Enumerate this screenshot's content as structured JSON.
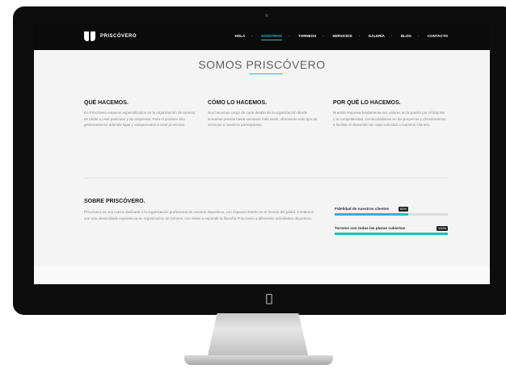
{
  "nav": {
    "logo_text": "PRISCÓVERO",
    "items": [
      "HOLA",
      "NOSOTROS",
      "TORNEOS",
      "SERVICIOS",
      "GALERÍA",
      "BLOG",
      "CONTACTO"
    ],
    "active_index": 1
  },
  "main": {
    "title": "SOMOS PRISCÓVERO",
    "columns": [
      {
        "heading": "QUÉ HACEMOS.",
        "text": "En Priscóvero estamos especializados en la organización de torneos de pádel a nivel particular y de empresas. Para el próximo año gestionaremos además ligas y campeonatos a nivel provincial."
      },
      {
        "heading": "CÓMO LO HACEMOS.",
        "text": "Nos hacemos cargo de cada detalle de la organización desde semanas previas hasta semanas más tarde, ofreciendo todo tipo de servicios a nuestros participantes."
      },
      {
        "heading": "POR QUÉ LO HACEMOS.",
        "text": "Nuestra empresa fundamenta sus valores en la pasión por el deporte y la competitividad, involucrándonos en los proyectos y ofreciéndonos a facilitar el desarrollo de cada actividad a nuestros clientes."
      }
    ],
    "about": {
      "heading": "SOBRE PRISCÓVERO.",
      "text": "Priscóvero es una marca dedicada a la organización profesional de eventos deportivos, con especial interés en el mundo del pádel. Contamos con una desarrollada experiencia en organización de torneos, con vistas a expandir la filosofía Priscóvero a diferentes actividades deportivas."
    },
    "skills": [
      {
        "label": "Fidelidad de nuestros clientes",
        "value": 65,
        "badge": "65%"
      },
      {
        "label": "Torneos con todas las plazas cubiertas",
        "value": 100,
        "badge": "100%"
      }
    ]
  },
  "colors": {
    "accent": "#2bb6c8",
    "nav_bg": "#0b0b0b"
  },
  "icons": {
    "logo": "priscovero-logo-icon",
    "apple": "apple-logo-icon"
  }
}
